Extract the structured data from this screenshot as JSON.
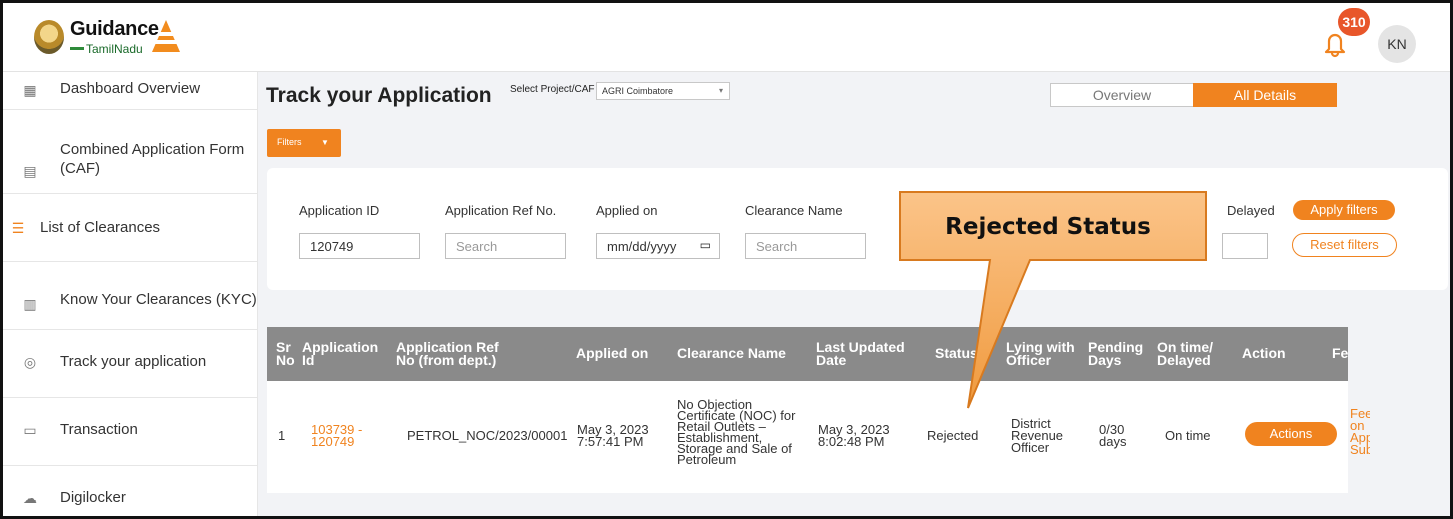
{
  "header": {
    "brand": "Guidance",
    "brand_sub": "TamilNadu",
    "notification_count": "310",
    "avatar_initials": "KN"
  },
  "sidebar": {
    "items": [
      {
        "label": "Dashboard Overview",
        "icon": "grid-icon"
      },
      {
        "label": "Combined Application Form (CAF)",
        "icon": "document-icon"
      },
      {
        "label": "List of Clearances",
        "icon": "list-icon"
      },
      {
        "label": "Know Your Clearances (KYC)",
        "icon": "book-icon"
      },
      {
        "label": "Track your application",
        "icon": "location-pin-icon"
      },
      {
        "label": "Transaction",
        "icon": "card-icon"
      },
      {
        "label": "Digilocker",
        "icon": "cloud-icon"
      }
    ]
  },
  "main": {
    "title": "Track your Application",
    "select_label": "Select Project/CAF",
    "select_value": "AGRI Coimbatore",
    "toggle": {
      "overview": "Overview",
      "all_details": "All Details"
    },
    "filters_label": "Filters",
    "filters": {
      "application_id": {
        "label": "Application ID",
        "value": "120749"
      },
      "app_ref": {
        "label": "Application Ref No.",
        "placeholder": "Search"
      },
      "applied_on": {
        "label": "Applied on",
        "placeholder": "mm/dd/yyyy"
      },
      "clearance_name": {
        "label": "Clearance Name",
        "placeholder": "Search"
      },
      "delayed_label": "Delayed"
    },
    "apply_filters": "Apply filters",
    "reset_filters": "Reset filters",
    "table": {
      "headers": [
        "Sr No",
        "Application Id",
        "Application Ref No (from dept.)",
        "Applied on",
        "Clearance Name",
        "Last Updated Date",
        "Status",
        "Lying with Officer",
        "Pending Days",
        "On time/ Delayed",
        "Action",
        "Fee"
      ],
      "rows": [
        {
          "sr": "1",
          "app_id": "103739 - 120749",
          "ref_no": "PETROL_NOC/2023/00001",
          "applied_on": "May 3, 2023 7:57:41 PM",
          "clearance": "No Objection Certificate (NOC) for Retail Outlets – Establishment, Storage and Sale of Petroleum",
          "last_updated": "May 3, 2023 8:02:48 PM",
          "status": "Rejected",
          "officer": "District Revenue Officer",
          "pending": "0/30 days",
          "ontime": "On time",
          "action": "Actions",
          "fee": "Fee on App Sub"
        }
      ]
    }
  },
  "callout": {
    "text": "Rejected Status",
    "color": "#f5a24a"
  }
}
